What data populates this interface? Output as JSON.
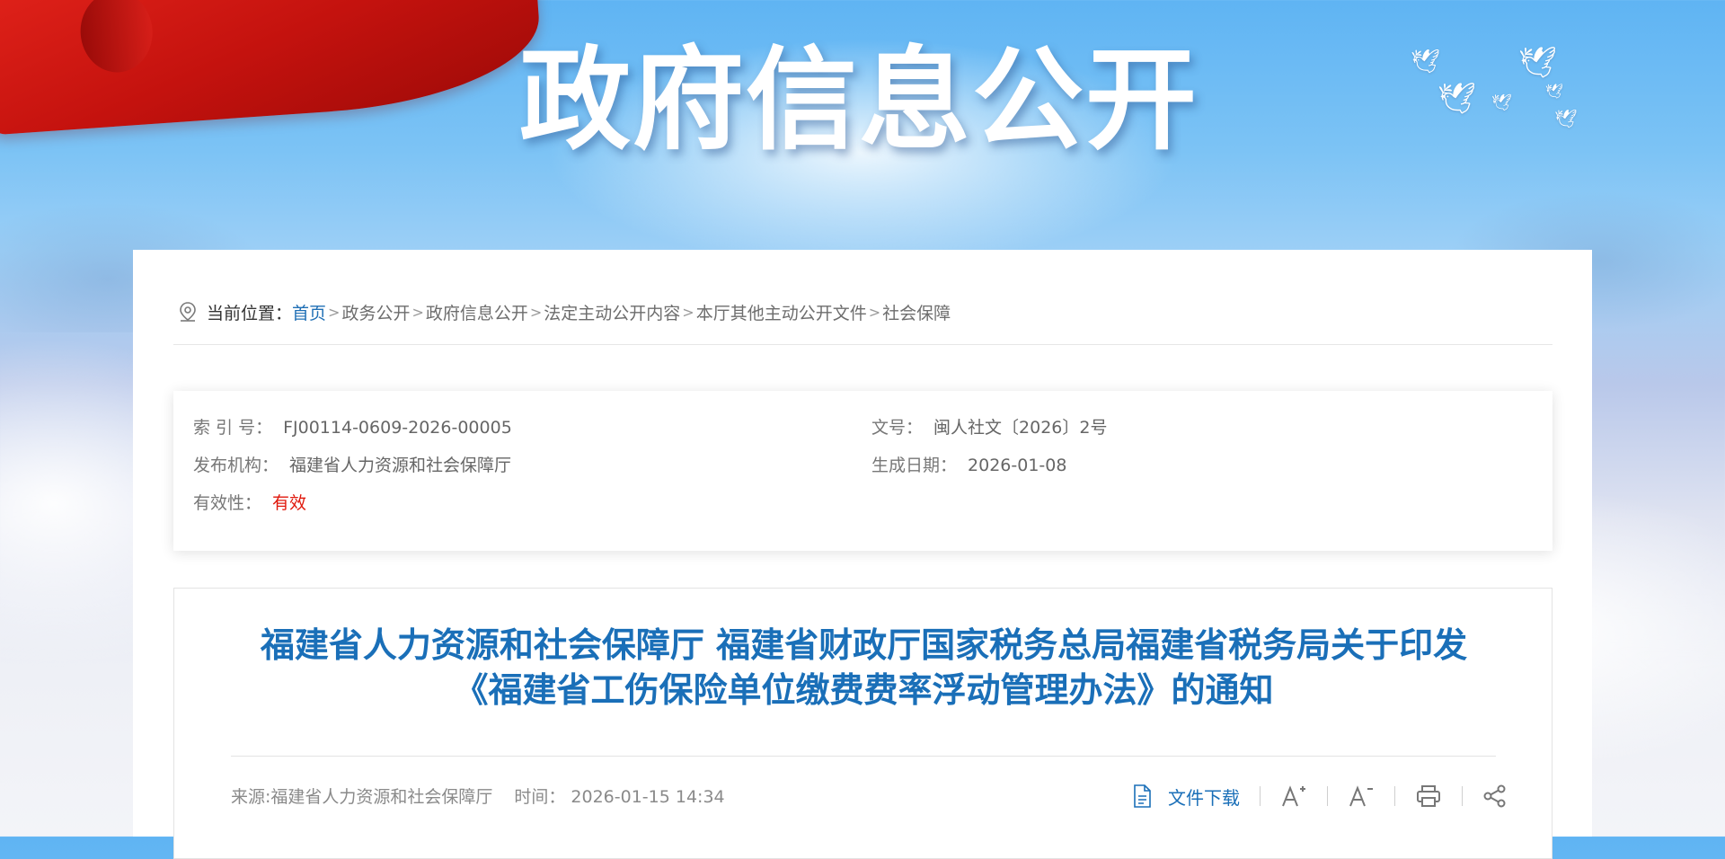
{
  "banner": {
    "title": "政府信息公开"
  },
  "breadcrumb": {
    "label": "当前位置：",
    "items": [
      "首页",
      "政务公开",
      "政府信息公开",
      "法定主动公开内容",
      "本厅其他主动公开文件",
      "社会保障"
    ],
    "separator": ">"
  },
  "meta": {
    "index_label": "索 引 号：",
    "index_value": "FJ00114-0609-2026-00005",
    "doc_no_label": "文号：",
    "doc_no_value": "闽人社文〔2026〕2号",
    "publisher_label": "发布机构：",
    "publisher_value": "福建省人力资源和社会保障厅",
    "date_label": "生成日期：",
    "date_value": "2026-01-08",
    "validity_label": "有效性：",
    "validity_value": "有效"
  },
  "article": {
    "title_line1": "福建省人力资源和社会保障厅 福建省财政厅国家税务总局福建省税务局关于印发",
    "title_line2": "《福建省工伤保险单位缴费费率浮动管理办法》的通知",
    "source": "来源:福建省人力资源和社会保障厅",
    "time_label": "时间：",
    "time_value": "2026-01-15 14:34"
  },
  "tools": {
    "download_label": "文件下载",
    "icons": [
      "document-icon",
      "font-increase-icon",
      "font-decrease-icon",
      "print-icon",
      "share-icon"
    ]
  },
  "colors": {
    "accent": "#1a6fb8",
    "valid_red": "#e0180c",
    "flag_red": "#d8201a"
  }
}
